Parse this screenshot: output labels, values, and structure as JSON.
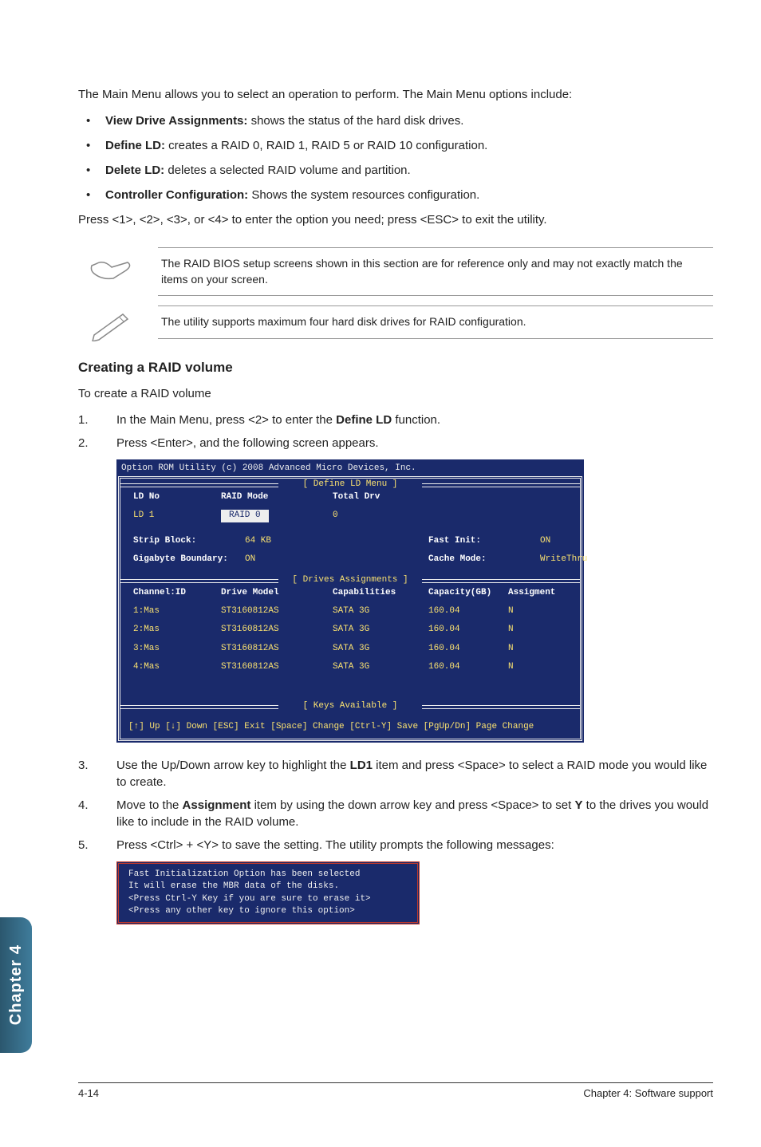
{
  "intro": "The Main Menu allows you to select an operation to perform. The Main Menu options include:",
  "bullets": [
    {
      "bold": "View Drive Assignments:",
      "rest": " shows the status of the hard disk drives."
    },
    {
      "bold": "Define LD:",
      "rest": " creates a RAID 0, RAID 1, RAID 5 or RAID 10 configuration."
    },
    {
      "bold": "Delete LD:",
      "rest": " deletes a selected RAID volume and partition."
    },
    {
      "bold": "Controller Configuration:",
      "rest": " Shows the system resources configuration."
    }
  ],
  "press_line": "Press <1>, <2>, <3>, or <4> to enter the option you need; press <ESC> to exit the utility.",
  "note1": "The RAID BIOS setup screens shown in this section are for reference only and may not exactly match the items on your screen.",
  "note2": "The utility supports maximum four hard disk drives for RAID configuration.",
  "section_title": "Creating a RAID volume",
  "section_sub": "To create a RAID volume",
  "steps": {
    "s1_num": "1.",
    "s1_a": "In the Main Menu, press <2> to enter the ",
    "s1_bold": "Define LD",
    "s1_b": " function.",
    "s2_num": "2.",
    "s2": "Press <Enter>, and the following screen appears.",
    "s3_num": "3.",
    "s3_a": "Use the Up/Down arrow key to highlight the ",
    "s3_bold": "LD1",
    "s3_b": " item and press <Space> to select a RAID mode you would like to create.",
    "s4_num": "4.",
    "s4_a": "Move to the ",
    "s4_bold1": "Assignment",
    "s4_b": " item by using the down arrow key and press <Space> to set ",
    "s4_bold2": "Y",
    "s4_c": " to the drives you would like to include in the RAID volume.",
    "s5_num": "5.",
    "s5": "Press <Ctrl> + <Y> to save the setting. The utility prompts the following messages:"
  },
  "bios": {
    "title": "Option ROM Utility (c) 2008 Advanced Micro Devices, Inc.",
    "define_label": "[ Define LD Menu ]",
    "hdr_ldno": "LD No",
    "hdr_raidmode": "RAID Mode",
    "hdr_totaldrv": "Total Drv",
    "row_ld": "LD 1",
    "row_raid": "RAID 0",
    "row_total": "0",
    "strip_label": "Strip Block:",
    "strip_val": "64 KB",
    "fast_label": "Fast Init:",
    "fast_val": "ON",
    "gb_label": "Gigabyte Boundary:",
    "gb_val": "ON",
    "cache_label": "Cache Mode:",
    "cache_val": "WriteThru",
    "drives_label": "[ Drives Assignments ]",
    "col_channel": "Channel:ID",
    "col_model": "Drive Model",
    "col_cap": "Capabilities",
    "col_capacity": "Capacity(GB)",
    "col_assign": "Assigment",
    "drives": [
      {
        "ch": "1:Mas",
        "model": "ST3160812AS",
        "cap": "SATA 3G",
        "capacity": "160.04",
        "assign": "N"
      },
      {
        "ch": "2:Mas",
        "model": "ST3160812AS",
        "cap": "SATA 3G",
        "capacity": "160.04",
        "assign": "N"
      },
      {
        "ch": "3:Mas",
        "model": "ST3160812AS",
        "cap": "SATA 3G",
        "capacity": "160.04",
        "assign": "N"
      },
      {
        "ch": "4:Mas",
        "model": "ST3160812AS",
        "cap": "SATA 3G",
        "capacity": "160.04",
        "assign": "N"
      }
    ],
    "keys_label": "[ Keys Available ]",
    "footer": "[↑] Up [↓] Down [ESC] Exit [Space] Change [Ctrl-Y] Save [PgUp/Dn] Page Change"
  },
  "redbox": {
    "l1": "Fast Initialization Option has been selected",
    "l2": "It will erase the MBR data of the disks.",
    "l3": "<Press Ctrl-Y Key if you are sure to erase it>",
    "l4": "<Press any other key to ignore this option>"
  },
  "side_tab": "Chapter 4",
  "footer_left": "4-14",
  "footer_right": "Chapter 4: Software support"
}
